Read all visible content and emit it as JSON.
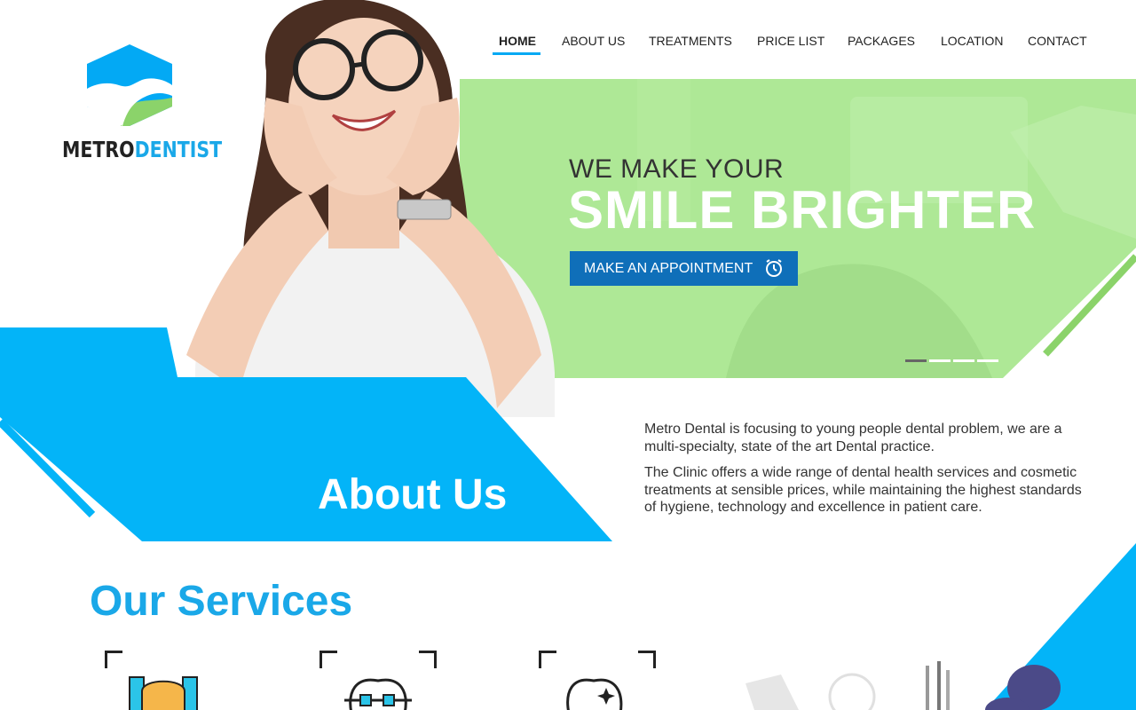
{
  "brand": {
    "name_part1": "METRO",
    "name_part2": "DENTIST",
    "primary_color": "#03a9f4",
    "accent_color": "#a8e58f"
  },
  "nav": {
    "items": [
      {
        "label": "HOME",
        "active": true
      },
      {
        "label": "ABOUT US",
        "active": false
      },
      {
        "label": "TREATMENTS",
        "active": false
      },
      {
        "label": "PRICE LIST",
        "active": false
      },
      {
        "label": "PACKAGES",
        "active": false
      },
      {
        "label": "LOCATION",
        "active": false
      },
      {
        "label": "CONTACT",
        "active": false
      }
    ]
  },
  "hero": {
    "tagline": "WE MAKE YOUR",
    "title": "SMILE  BRIGHTER",
    "cta_label": "MAKE AN APPOINTMENT",
    "cta_icon": "alarm-clock-icon",
    "slides": 4,
    "active_slide": 0
  },
  "about": {
    "title": "About Us",
    "paragraphs": [
      "Metro Dental is focusing to young people dental problem, we are a multi-specialty, state of the art Dental practice.",
      "The Clinic offers a wide range of dental health services and cosmetic treatments at sensible prices, while maintaining the highest standards of hygiene, technology and excellence in patient care."
    ]
  },
  "services": {
    "title": "Our Services",
    "items": [
      {
        "icon": "tooth-implant-icon"
      },
      {
        "icon": "braces-icon"
      },
      {
        "icon": "tooth-whitening-icon"
      }
    ]
  }
}
